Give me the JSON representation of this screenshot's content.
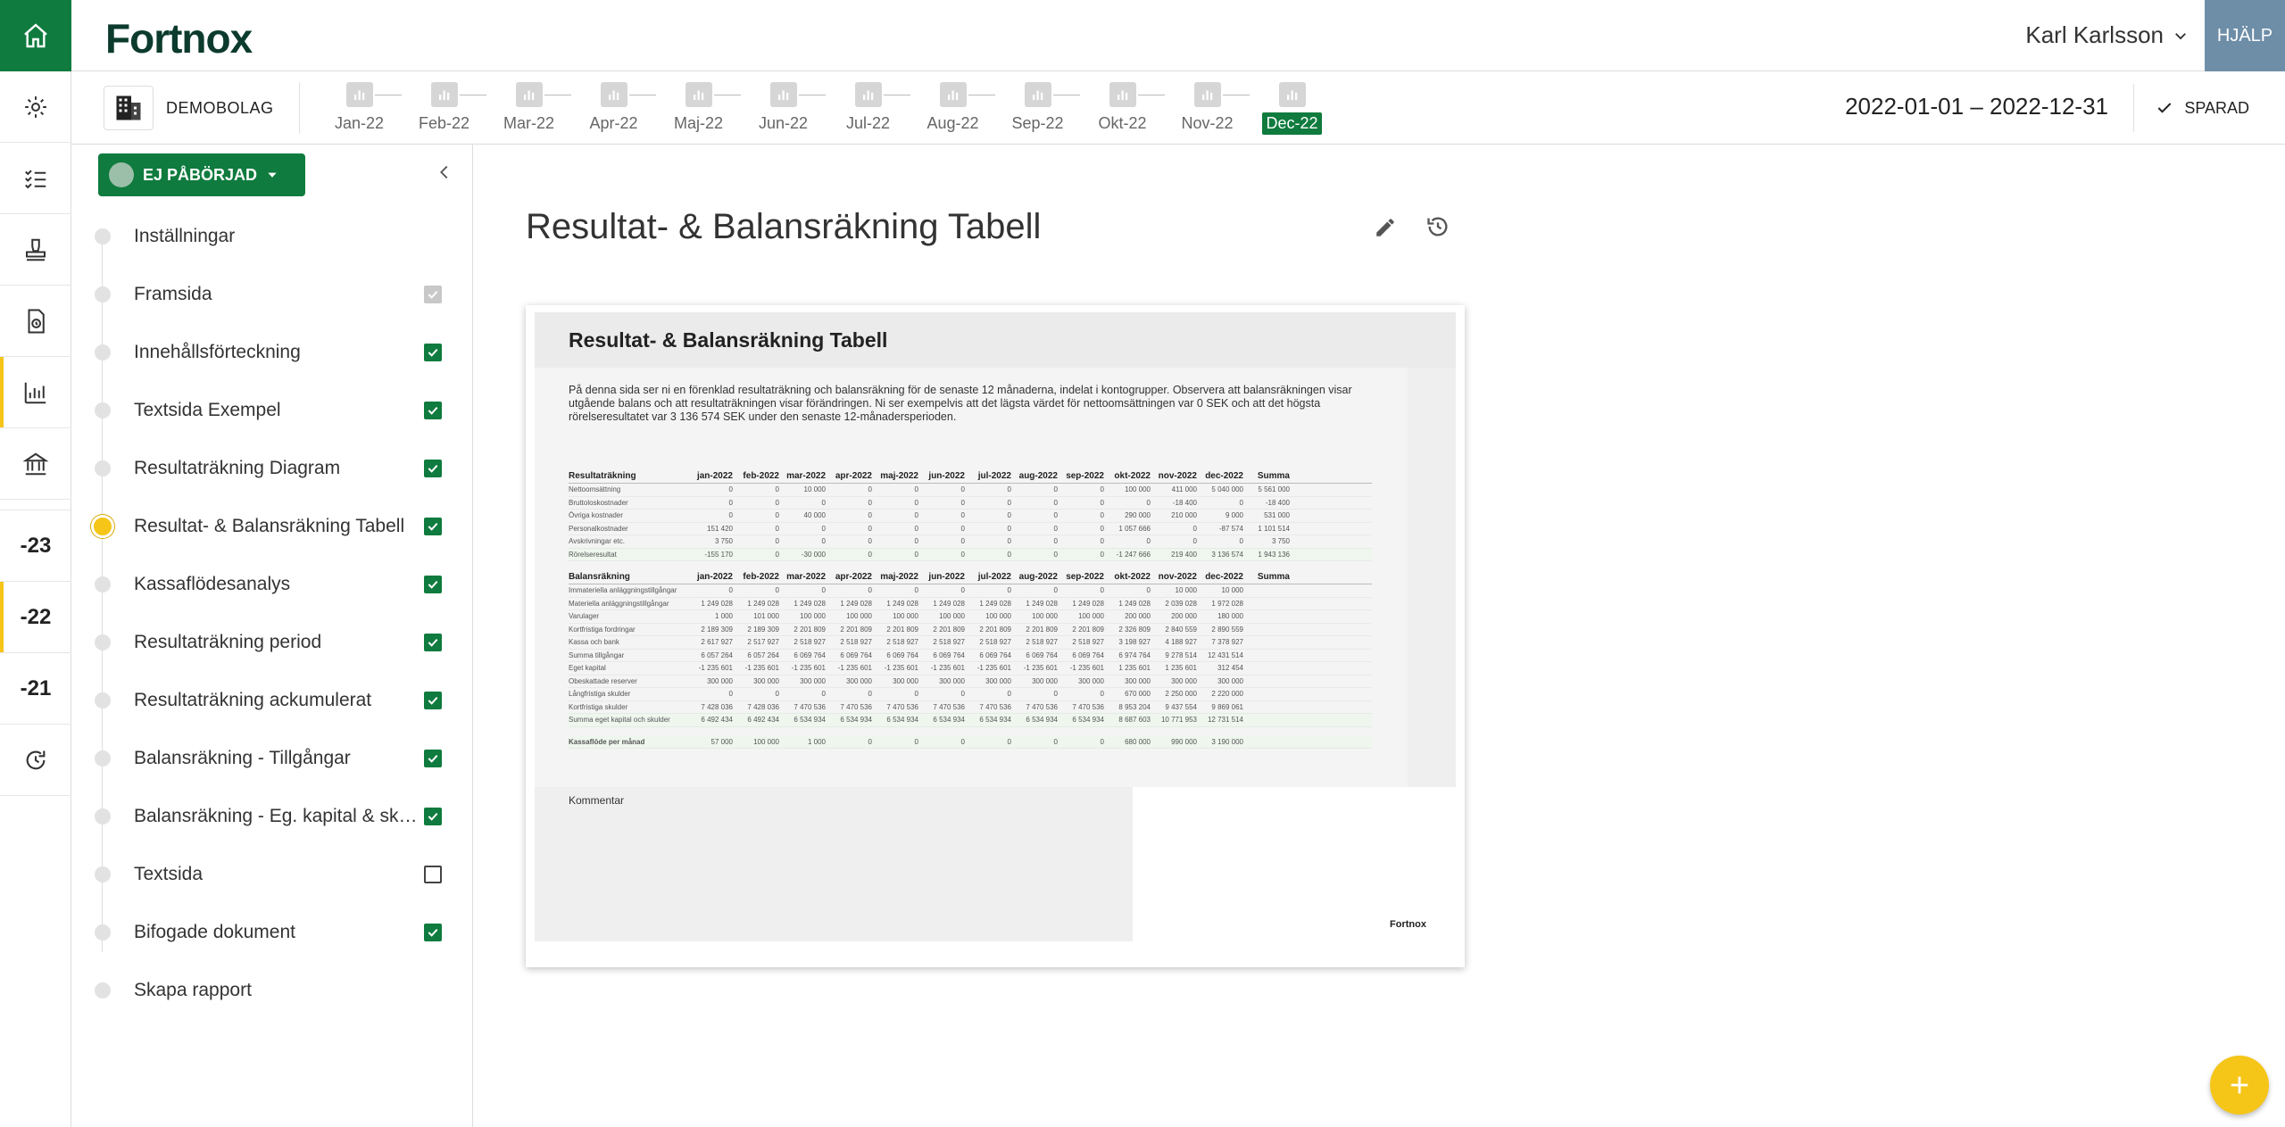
{
  "app": {
    "logo": "Fortnox",
    "help_label": "HJÄLP"
  },
  "user": {
    "name": "Karl Karlsson"
  },
  "company": {
    "name": "DEMOBOLAG"
  },
  "months": [
    "Jan-22",
    "Feb-22",
    "Mar-22",
    "Apr-22",
    "Maj-22",
    "Jun-22",
    "Jul-22",
    "Aug-22",
    "Sep-22",
    "Okt-22",
    "Nov-22",
    "Dec-22"
  ],
  "selected_month": "Dec-22",
  "date_range": "2022-01-01 – 2022-12-31",
  "saved_label": "SPARAD",
  "rail": {
    "years": [
      "-23",
      "-22",
      "-21"
    ]
  },
  "status": {
    "label": "EJ PÅBÖRJAD"
  },
  "nav": [
    {
      "label": "Inställningar",
      "check": "none"
    },
    {
      "label": "Framsida",
      "check": "grey"
    },
    {
      "label": "Innehållsförteckning",
      "check": "on"
    },
    {
      "label": "Textsida Exempel",
      "check": "on"
    },
    {
      "label": "Resultaträkning Diagram",
      "check": "on"
    },
    {
      "label": "Resultat- & Balansräkning Tabell",
      "check": "on",
      "current": true
    },
    {
      "label": "Kassaflödesanalys",
      "check": "on"
    },
    {
      "label": "Resultaträkning period",
      "check": "on"
    },
    {
      "label": "Resultaträkning ackumulerat",
      "check": "on"
    },
    {
      "label": "Balansräkning - Tillgångar",
      "check": "on"
    },
    {
      "label": "Balansräkning - Eg. kapital & skulder",
      "check": "on"
    },
    {
      "label": "Textsida",
      "check": "off"
    },
    {
      "label": "Bifogade dokument",
      "check": "on"
    },
    {
      "label": "Skapa rapport",
      "check": "none"
    }
  ],
  "main": {
    "title": "Resultat- & Balansräkning Tabell"
  },
  "preview": {
    "title": "Resultat- & Balansräkning Tabell",
    "intro": "På denna sida ser ni en förenklad resultaträkning och balansräkning för de senaste 12 månaderna, indelat i kontogrupper. Observera att balansräkningen visar utgående balans och att resultaträkningen visar förändringen. Ni ser exempelvis att det lägsta värdet för nettoomsättningen var 0 SEK och att det högsta rörelseresultatet var 3 136 574 SEK under den senaste 12-månadersperioden.",
    "comment_label": "Kommentar",
    "footer_logo": "Fortnox",
    "columns": [
      "jan-2022",
      "feb-2022",
      "mar-2022",
      "apr-2022",
      "maj-2022",
      "jun-2022",
      "jul-2022",
      "aug-2022",
      "sep-2022",
      "okt-2022",
      "nov-2022",
      "dec-2022",
      "Summa"
    ],
    "income": {
      "header": "Resultaträkning",
      "rows": [
        {
          "label": "Nettoomsättning",
          "values": [
            "0",
            "0",
            "10 000",
            "0",
            "0",
            "0",
            "0",
            "0",
            "0",
            "100 000",
            "411 000",
            "5 040 000",
            "5 561 000"
          ]
        },
        {
          "label": "Bruttoloskostnader",
          "values": [
            "0",
            "0",
            "0",
            "0",
            "0",
            "0",
            "0",
            "0",
            "0",
            "0",
            "-18 400",
            "0",
            "-18 400"
          ]
        },
        {
          "label": "Övriga kostnader",
          "values": [
            "0",
            "0",
            "40 000",
            "0",
            "0",
            "0",
            "0",
            "0",
            "0",
            "290 000",
            "210 000",
            "9 000",
            "531 000"
          ]
        },
        {
          "label": "Personalkostnader",
          "values": [
            "151 420",
            "0",
            "0",
            "0",
            "0",
            "0",
            "0",
            "0",
            "0",
            "1 057 666",
            "0",
            "-87 574",
            "1 101 514"
          ]
        },
        {
          "label": "Avskrivningar etc.",
          "values": [
            "3 750",
            "0",
            "0",
            "0",
            "0",
            "0",
            "0",
            "0",
            "0",
            "0",
            "0",
            "0",
            "3 750"
          ]
        },
        {
          "label": "Rörelseresultat",
          "values": [
            "-155 170",
            "0",
            "-30 000",
            "0",
            "0",
            "0",
            "0",
            "0",
            "0",
            "-1 247 666",
            "219 400",
            "3 136 574",
            "1 943 136"
          ],
          "total": true
        }
      ]
    },
    "balance": {
      "header": "Balansräkning",
      "rows": [
        {
          "label": "Immateriella anläggningstillgångar",
          "values": [
            "0",
            "0",
            "0",
            "0",
            "0",
            "0",
            "0",
            "0",
            "0",
            "0",
            "10 000",
            "10 000",
            ""
          ]
        },
        {
          "label": "Materiella anläggningstillgångar",
          "values": [
            "1 249 028",
            "1 249 028",
            "1 249 028",
            "1 249 028",
            "1 249 028",
            "1 249 028",
            "1 249 028",
            "1 249 028",
            "1 249 028",
            "1 249 028",
            "2 039 028",
            "1 972 028",
            ""
          ]
        },
        {
          "label": "Varulager",
          "values": [
            "1 000",
            "101 000",
            "100 000",
            "100 000",
            "100 000",
            "100 000",
            "100 000",
            "100 000",
            "100 000",
            "200 000",
            "200 000",
            "180 000",
            ""
          ]
        },
        {
          "label": "Kortfristiga fordringar",
          "values": [
            "2 189 309",
            "2 189 309",
            "2 201 809",
            "2 201 809",
            "2 201 809",
            "2 201 809",
            "2 201 809",
            "2 201 809",
            "2 201 809",
            "2 326 809",
            "2 840 559",
            "2 890 559",
            ""
          ]
        },
        {
          "label": "Kassa och bank",
          "values": [
            "2 617 927",
            "2 517 927",
            "2 518 927",
            "2 518 927",
            "2 518 927",
            "2 518 927",
            "2 518 927",
            "2 518 927",
            "2 518 927",
            "3 198 927",
            "4 188 927",
            "7 378 927",
            ""
          ]
        },
        {
          "label": "Summa tillgångar",
          "values": [
            "6 057 264",
            "6 057 264",
            "6 069 764",
            "6 069 764",
            "6 069 764",
            "6 069 764",
            "6 069 764",
            "6 069 764",
            "6 069 764",
            "6 974 764",
            "9 278 514",
            "12 431 514",
            ""
          ]
        },
        {
          "label": "Eget kapital",
          "values": [
            "-1 235 601",
            "-1 235 601",
            "-1 235 601",
            "-1 235 601",
            "-1 235 601",
            "-1 235 601",
            "-1 235 601",
            "-1 235 601",
            "-1 235 601",
            "1 235 601",
            "1 235 601",
            "312 454",
            ""
          ]
        },
        {
          "label": "Obeskattade reserver",
          "values": [
            "300 000",
            "300 000",
            "300 000",
            "300 000",
            "300 000",
            "300 000",
            "300 000",
            "300 000",
            "300 000",
            "300 000",
            "300 000",
            "300 000",
            ""
          ]
        },
        {
          "label": "Långfristiga skulder",
          "values": [
            "0",
            "0",
            "0",
            "0",
            "0",
            "0",
            "0",
            "0",
            "0",
            "670 000",
            "2 250 000",
            "2 220 000",
            ""
          ]
        },
        {
          "label": "Kortfristiga skulder",
          "values": [
            "7 428 036",
            "7 428 036",
            "7 470 536",
            "7 470 536",
            "7 470 536",
            "7 470 536",
            "7 470 536",
            "7 470 536",
            "7 470 536",
            "8 953 204",
            "9 437 554",
            "9 869 061",
            ""
          ]
        },
        {
          "label": "Summa eget kapital och skulder",
          "values": [
            "6 492 434",
            "6 492 434",
            "6 534 934",
            "6 534 934",
            "6 534 934",
            "6 534 934",
            "6 534 934",
            "6 534 934",
            "6 534 934",
            "8 687 603",
            "10 771 953",
            "12 731 514",
            ""
          ],
          "total": true
        }
      ]
    },
    "cashflow": {
      "label": "Kassaflöde per månad",
      "values": [
        "57 000",
        "100 000",
        "1 000",
        "0",
        "0",
        "0",
        "0",
        "0",
        "0",
        "680 000",
        "990 000",
        "3 190 000",
        ""
      ]
    }
  }
}
